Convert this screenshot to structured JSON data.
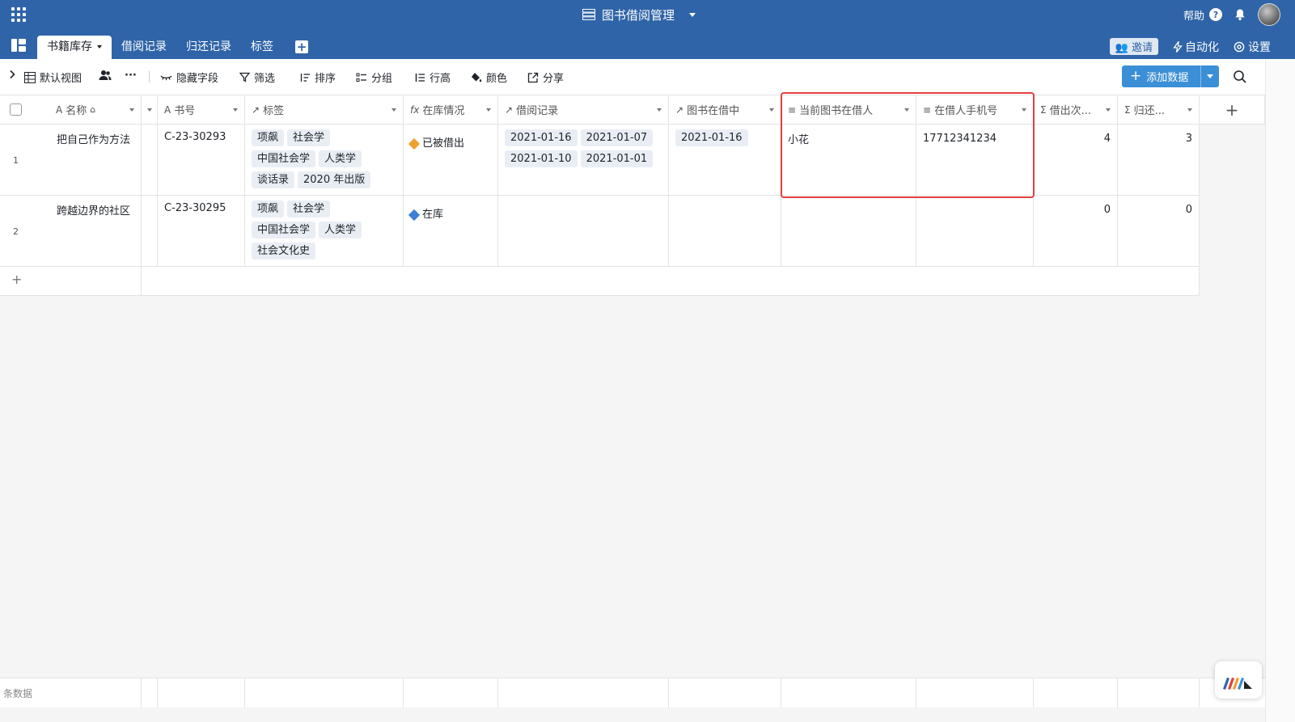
{
  "app": {
    "title": "图书借阅管理",
    "help_label": "帮助"
  },
  "tabs": [
    {
      "label": "书籍库存",
      "active": true
    },
    {
      "label": "借阅记录"
    },
    {
      "label": "归还记录"
    },
    {
      "label": "标签"
    }
  ],
  "tab_actions": {
    "invite": "邀请",
    "automation": "自动化",
    "settings": "设置"
  },
  "toolbar": {
    "view": "默认视图",
    "hide_fields": "隐藏字段",
    "filter": "筛选",
    "sort": "排序",
    "group": "分组",
    "row_height": "行高",
    "color": "颜色",
    "share": "分享",
    "add_data": "添加数据"
  },
  "columns": {
    "name": "名称",
    "book_no": "书号",
    "tags": "标签",
    "stock_status": "在库情况",
    "borrow_records": "借阅记录",
    "in_borrow": "图书在借中",
    "current_borrower": "当前图书在借人",
    "borrower_phone": "在借人手机号",
    "borrow_count": "借出次...",
    "return_count": "归还..."
  },
  "rows": [
    {
      "num": "1",
      "name": "把自己作为方法",
      "book_no": "C-23-30293",
      "tags": [
        "项飙",
        "社会学",
        "中国社会学",
        "人类学",
        "谈话录",
        "2020 年出版"
      ],
      "status": "已被借出",
      "status_color": "#f0a030",
      "borrow_records": [
        "2021-01-16",
        "2021-01-07",
        "2021-01-10",
        "2021-01-01"
      ],
      "in_borrow": "2021-01-16",
      "borrower": "小花",
      "phone": "17712341234",
      "borrow_count": "4",
      "return_count": "3"
    },
    {
      "num": "2",
      "name": "跨越边界的社区",
      "book_no": "C-23-30295",
      "tags": [
        "项飙",
        "社会学",
        "中国社会学",
        "人类学",
        "社会文化史"
      ],
      "status": "在库",
      "status_color": "#3b7fd6",
      "borrow_records": [],
      "in_borrow": "",
      "borrower": "",
      "phone": "",
      "borrow_count": "0",
      "return_count": "0"
    }
  ],
  "footer": {
    "label": "条数据"
  },
  "colors": {
    "topbar": "#2f64a8",
    "accent": "#3b8fd6",
    "highlight": "#e53e3e"
  }
}
